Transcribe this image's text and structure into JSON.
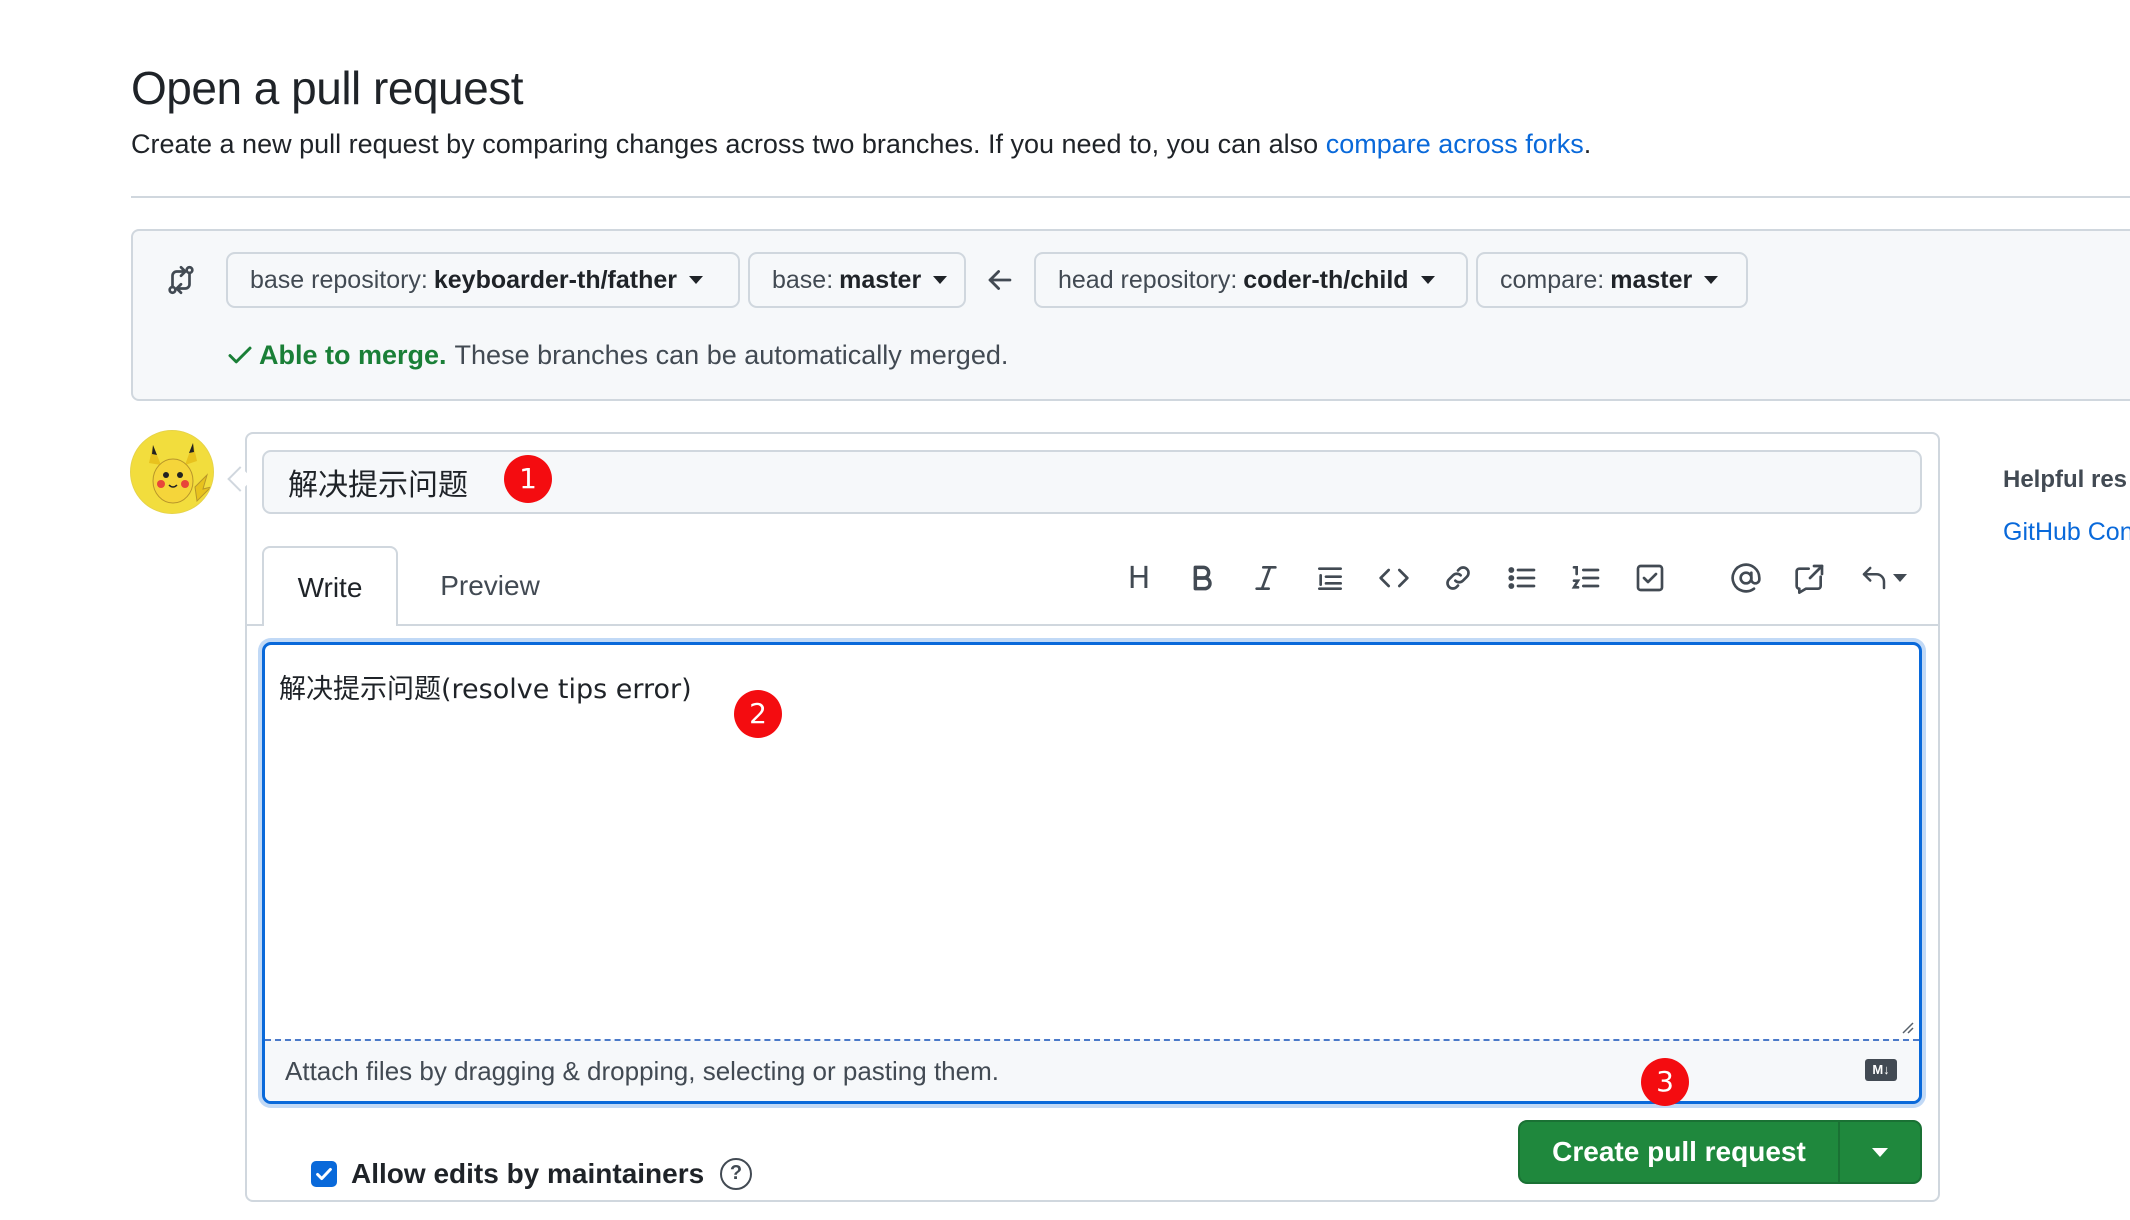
{
  "page": {
    "title": "Open a pull request",
    "subtitle": "Create a new pull request by comparing changes across two branches. If you need to, you can also ",
    "subtitle_link": "compare across forks",
    "subtitle_end": "."
  },
  "compare": {
    "base_repo_label": "base repository:",
    "base_repo_value": "keyboarder-th/father",
    "base_label": "base:",
    "base_value": "master",
    "head_repo_label": "head repository:",
    "head_repo_value": "coder-th/child",
    "compare_label": "compare:",
    "compare_value": "master",
    "merge_status": "Able to merge.",
    "merge_text": "These branches can be automatically merged."
  },
  "form": {
    "title_value": "解决提示问题",
    "tab_write": "Write",
    "tab_preview": "Preview",
    "toolbar": {
      "heading": "H"
    },
    "body_value": "解决提示问题(resolve tips error)",
    "attach_text": "Attach files by dragging & dropping, selecting or pasting them.",
    "markdown_badge": "M↓",
    "allow_edits_label": "Allow edits by maintainers",
    "help": "?",
    "create_button": "Create pull request"
  },
  "sidebar": {
    "title": "Helpful res",
    "link": "GitHub Con"
  },
  "annotations": [
    "1",
    "2",
    "3"
  ],
  "colors": {
    "accent": "#0969da",
    "success": "#1a7f37",
    "primary_button": "#1f883d",
    "annotation": "#f40c10"
  }
}
